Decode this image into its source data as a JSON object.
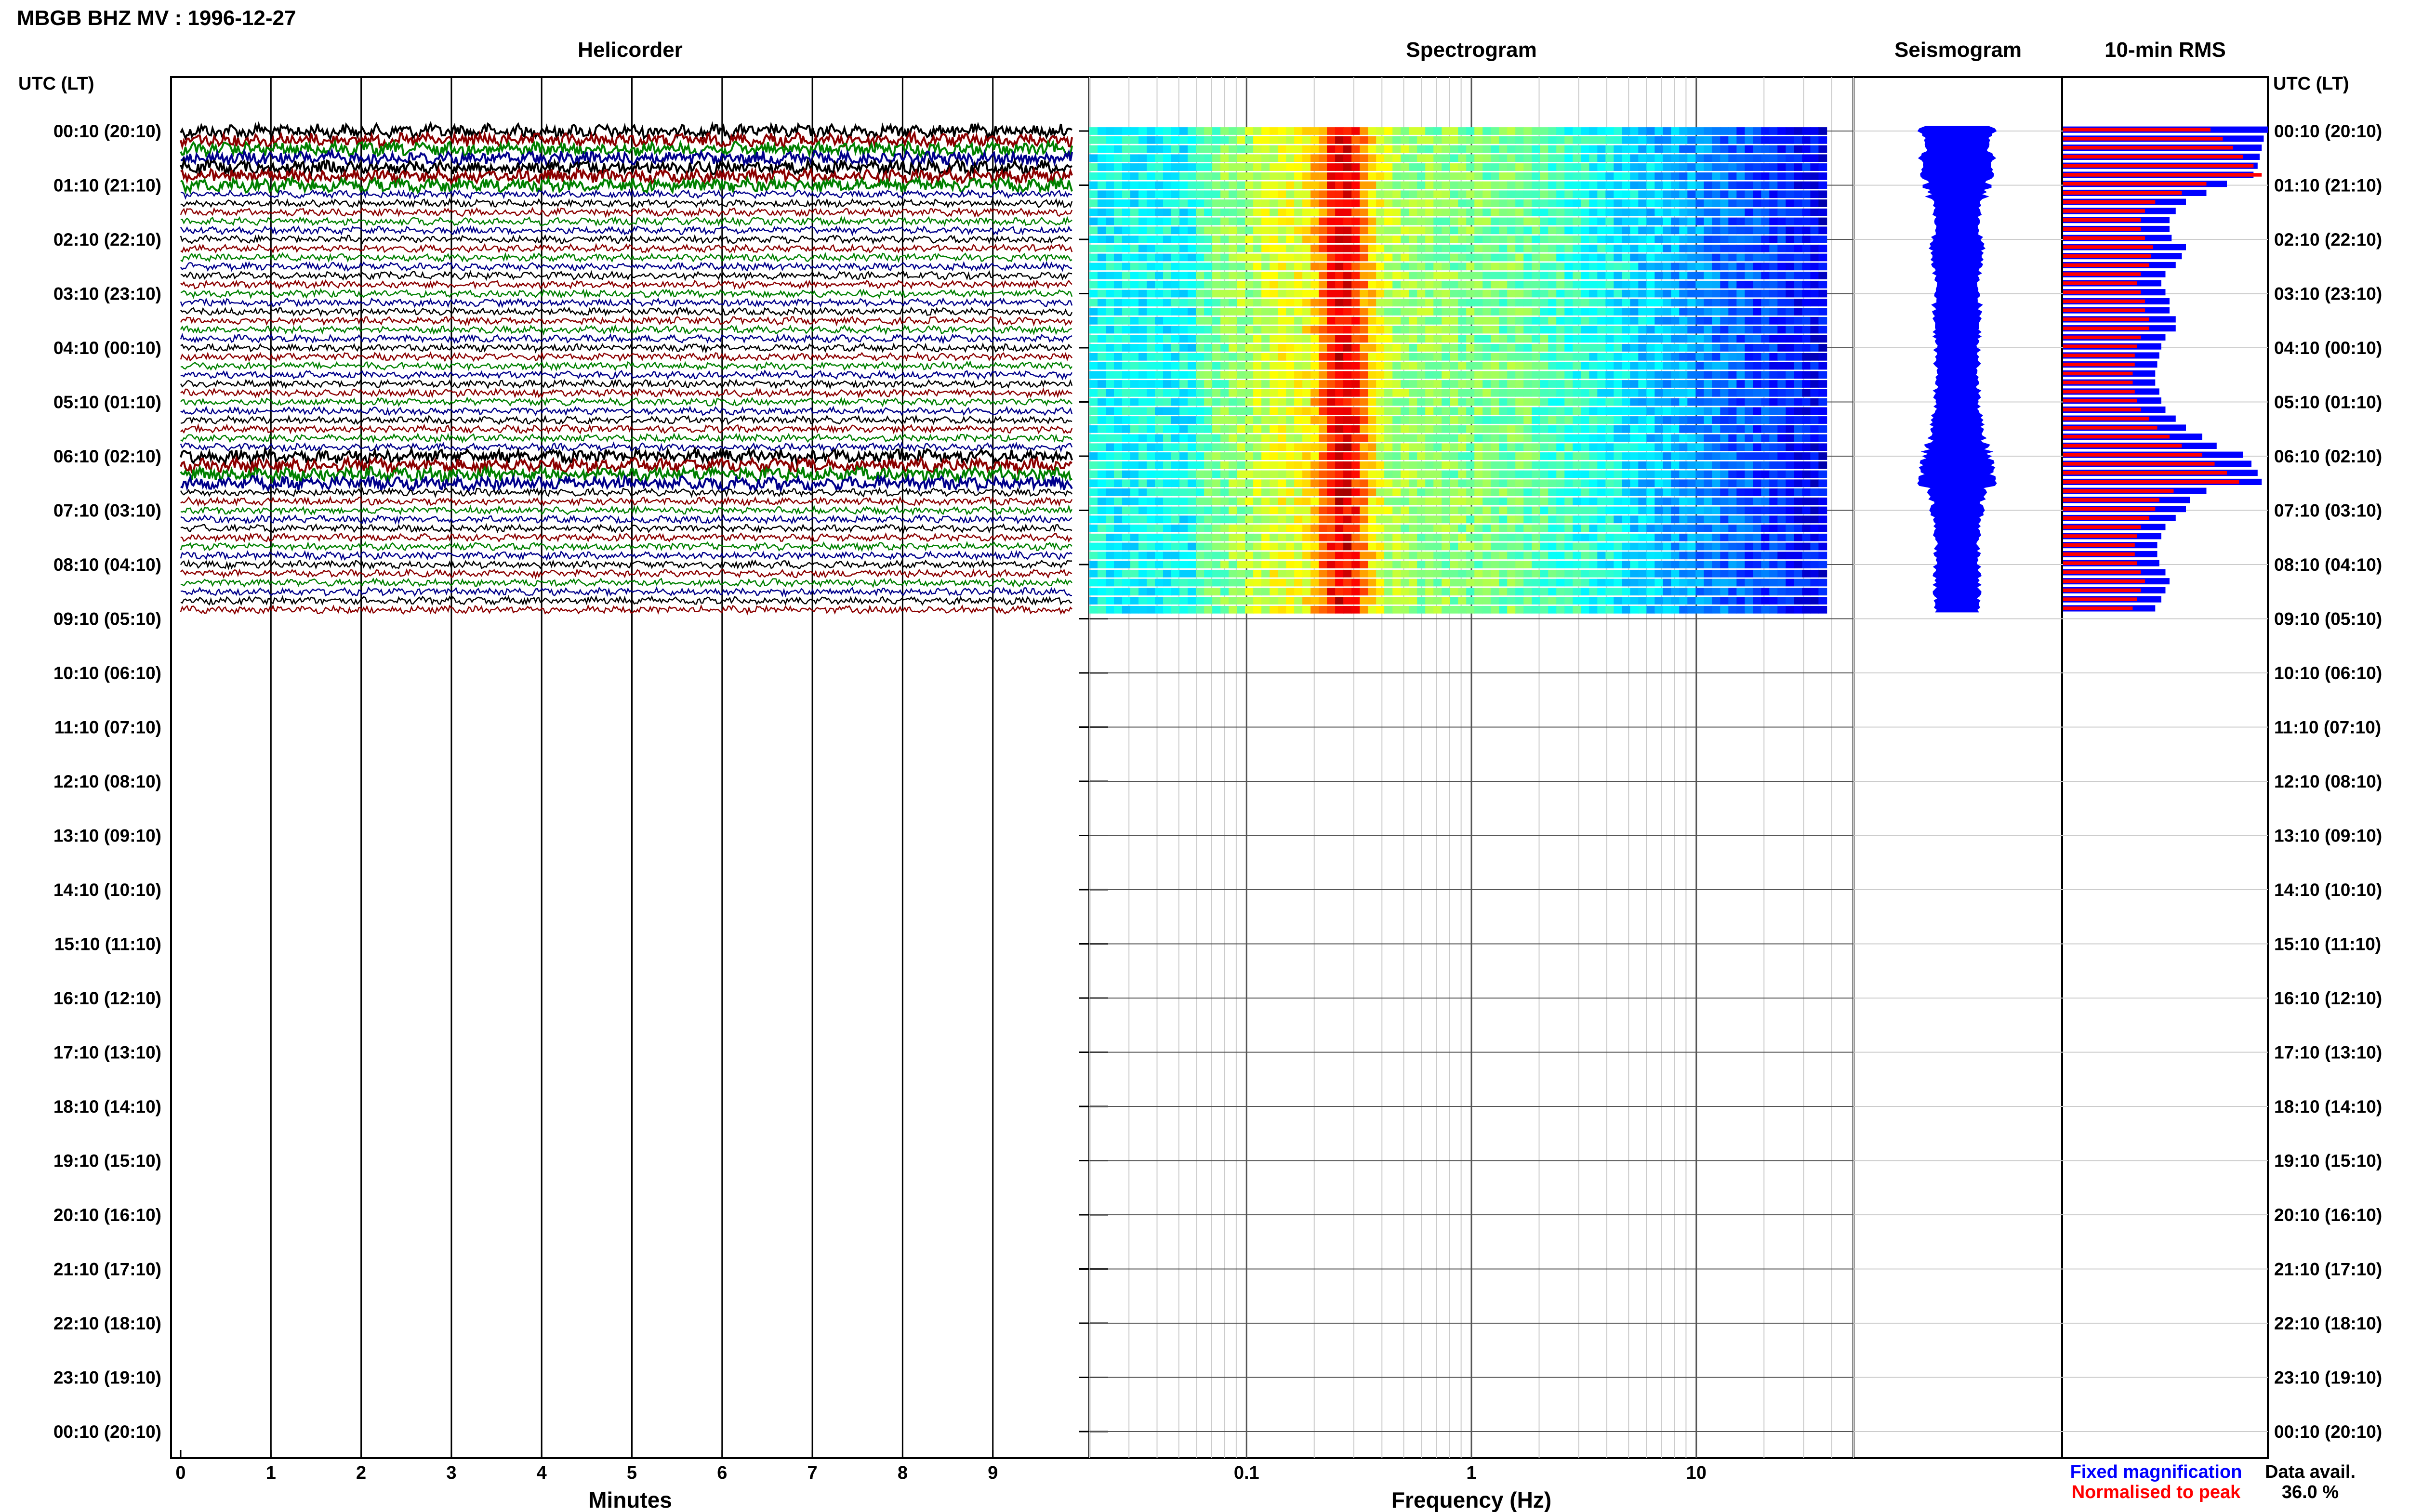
{
  "header": {
    "title": "MBGB BHZ MV : 1996-12-27"
  },
  "panels": {
    "helicorder_title": "Helicorder",
    "spectrogram_title": "Spectrogram",
    "seismogram_title": "Seismogram",
    "rms_title": "10-min RMS"
  },
  "axes": {
    "left_time_header": "UTC (LT)",
    "right_time_header": "UTC (LT)",
    "helicorder_xlabel": "Minutes",
    "spectrogram_xlabel": "Frequency (Hz)"
  },
  "legend": {
    "fixed_label": "Fixed magnification",
    "fixed_color": "#0000ff",
    "normalised_label": "Normalised to peak",
    "normalised_color": "#ff0000",
    "avail_label": "Data avail.",
    "avail_value": "36.0 %"
  },
  "chart_data": [
    {
      "type": "line",
      "name": "Helicorder",
      "x_label": "Minutes",
      "x_ticks": [
        "0",
        "1",
        "2",
        "3",
        "4",
        "5",
        "6",
        "7",
        "8",
        "9"
      ],
      "xlim": [
        0,
        10
      ],
      "time_labels": [
        "00:10 (20:10)",
        "01:10 (21:10)",
        "02:10 (22:10)",
        "03:10 (23:10)",
        "04:10 (00:10)",
        "05:10 (01:10)",
        "06:10 (02:10)",
        "07:10 (03:10)",
        "08:10 (04:10)",
        "09:10 (05:10)",
        "10:10 (06:10)",
        "11:10 (07:10)",
        "12:10 (08:10)",
        "13:10 (09:10)",
        "14:10 (10:10)",
        "15:10 (11:10)",
        "16:10 (12:10)",
        "17:10 (13:10)",
        "18:10 (14:10)",
        "19:10 (15:10)",
        "20:10 (16:10)",
        "21:10 (17:10)",
        "22:10 (18:10)",
        "23:10 (19:10)",
        "00:10 (20:10)"
      ],
      "trace_colors": [
        "#000000",
        "#8b0000",
        "#008000",
        "#00008b"
      ],
      "rows_with_data": 54,
      "rows_total": 144
    },
    {
      "type": "heatmap",
      "name": "Spectrogram",
      "x_label": "Frequency (Hz)",
      "x_scale": "log",
      "x_ticks": [
        "0.1",
        "1",
        "10"
      ],
      "xlim": [
        0.02,
        50
      ],
      "data_rows": 54,
      "colormap": "jet",
      "peak_band_hz": [
        0.2,
        0.35
      ]
    },
    {
      "type": "area",
      "name": "Seismogram",
      "color": "#0000ff",
      "data_rows": 54
    },
    {
      "type": "bar",
      "name": "10-min RMS",
      "series": [
        {
          "name": "Fixed magnification",
          "color": "#0000ff",
          "values": [
            1.0,
            0.98,
            0.97,
            0.96,
            0.95,
            0.93,
            0.8,
            0.7,
            0.6,
            0.55,
            0.52,
            0.52,
            0.53,
            0.6,
            0.58,
            0.55,
            0.5,
            0.48,
            0.5,
            0.52,
            0.52,
            0.55,
            0.55,
            0.5,
            0.48,
            0.47,
            0.46,
            0.45,
            0.45,
            0.47,
            0.48,
            0.5,
            0.55,
            0.6,
            0.68,
            0.75,
            0.88,
            0.92,
            0.95,
            0.97,
            0.7,
            0.62,
            0.6,
            0.55,
            0.5,
            0.48,
            0.46,
            0.46,
            0.47,
            0.5,
            0.52,
            0.5,
            0.48,
            0.45
          ]
        },
        {
          "name": "Normalised to peak",
          "color": "#ff0000",
          "values": [
            0.72,
            0.78,
            0.83,
            0.88,
            0.93,
            0.97,
            0.7,
            0.58,
            0.45,
            0.4,
            0.38,
            0.38,
            0.4,
            0.44,
            0.43,
            0.42,
            0.38,
            0.36,
            0.38,
            0.4,
            0.4,
            0.42,
            0.42,
            0.38,
            0.36,
            0.35,
            0.35,
            0.34,
            0.34,
            0.35,
            0.36,
            0.38,
            0.42,
            0.46,
            0.52,
            0.58,
            0.68,
            0.74,
            0.8,
            0.86,
            0.54,
            0.47,
            0.45,
            0.42,
            0.38,
            0.36,
            0.35,
            0.35,
            0.36,
            0.38,
            0.4,
            0.38,
            0.36,
            0.34
          ]
        }
      ]
    }
  ]
}
